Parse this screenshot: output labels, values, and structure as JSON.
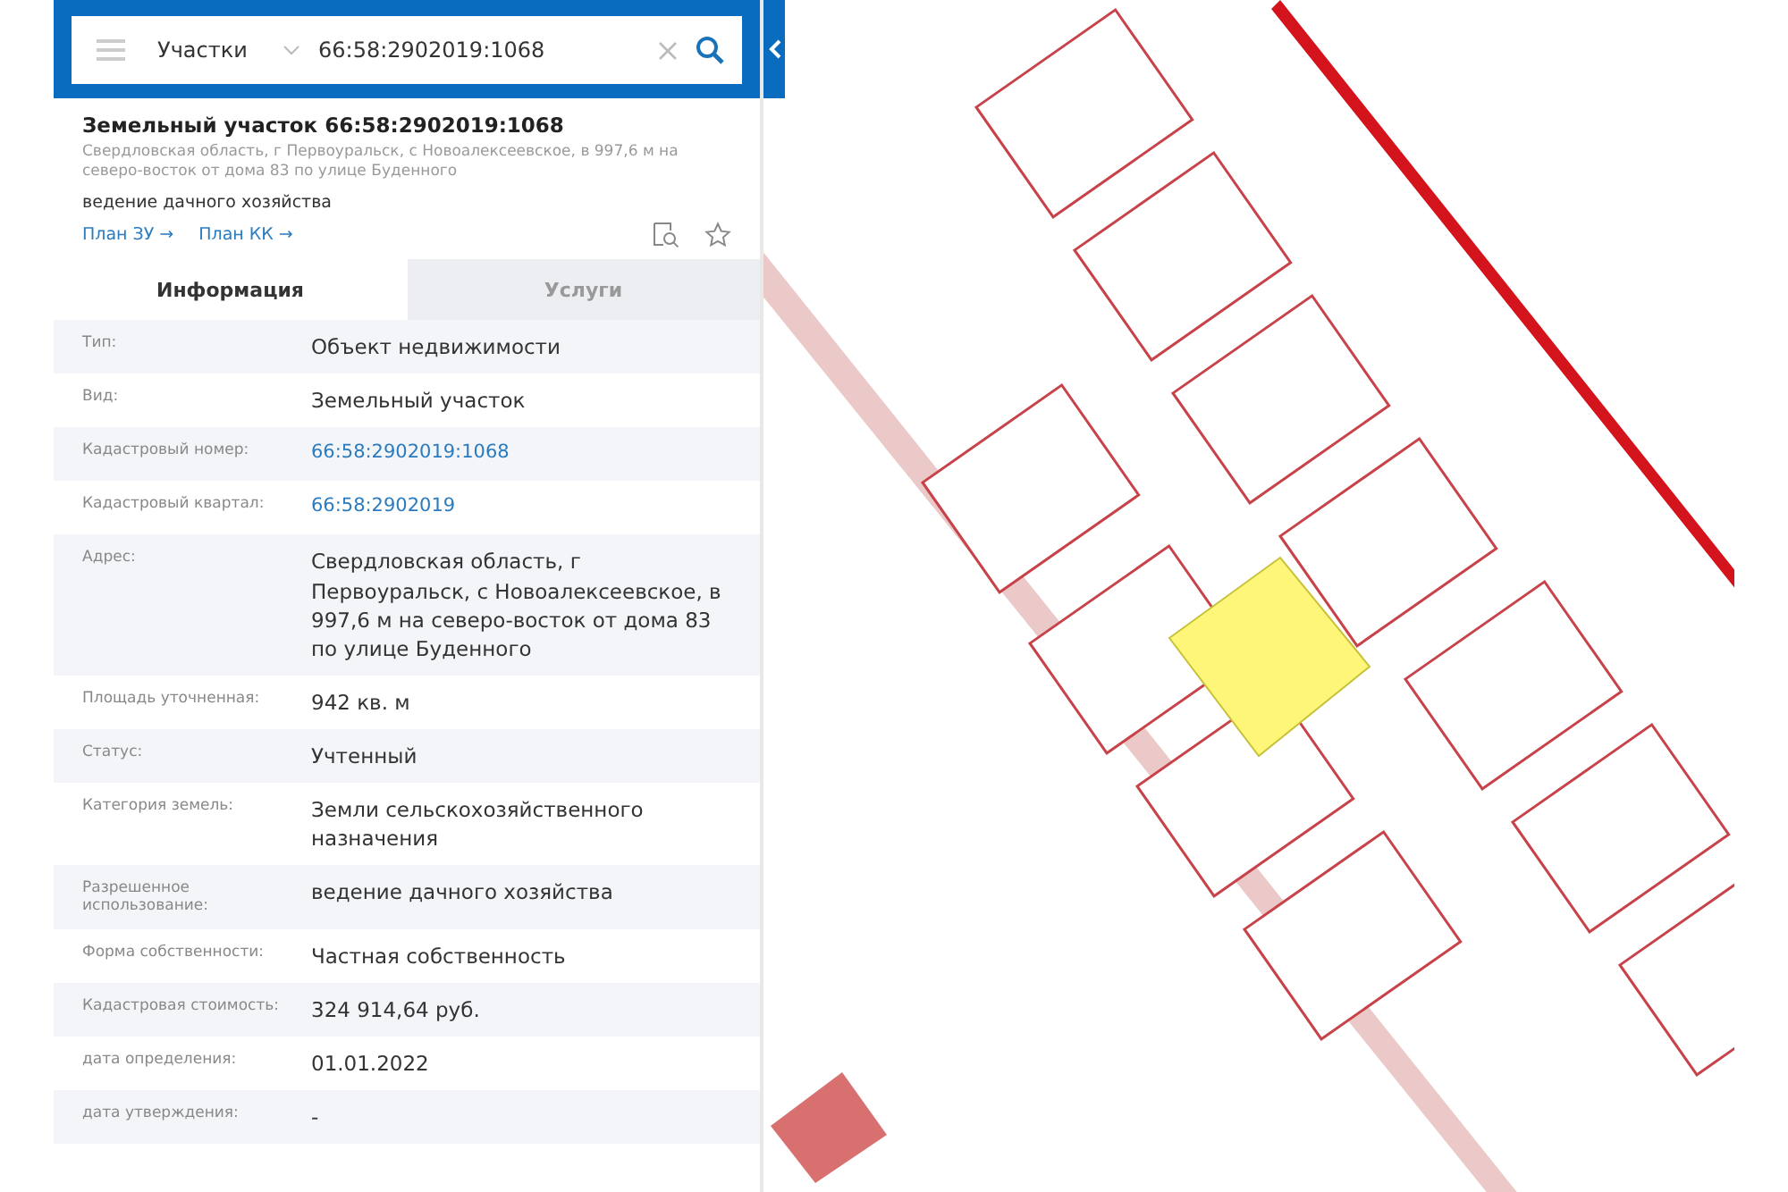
{
  "search": {
    "category": "Участки",
    "value": "66:58:2902019:1068"
  },
  "object": {
    "title": "Земельный участок 66:58:2902019:1068",
    "address": "Свердловская область, г Первоуральск, с Новоалексеевское, в 997,6 м на северо-восток от дома 83 по улице Буденного",
    "purpose": "ведение дачного хозяйства",
    "links": [
      "План ЗУ →",
      "План КК →"
    ]
  },
  "tabs": [
    {
      "label": "Информация",
      "selected": true
    },
    {
      "label": "Услуги",
      "selected": false
    }
  ],
  "rows": [
    {
      "label": "Тип:",
      "value": "Объект недвижимости",
      "kind": "text"
    },
    {
      "label": "Вид:",
      "value": "Земельный участок",
      "kind": "text"
    },
    {
      "label": "Кадастровый номер:",
      "value": "66:58:2902019:1068",
      "kind": "link"
    },
    {
      "label": "Кадастровый квартал:",
      "value": "66:58:2902019",
      "kind": "link"
    },
    {
      "label": "Адрес:",
      "value": "Свердловская область, г Первоуральск, с Новоалексеевское, в 997,6 м на северо-восток от дома 83 по улице Буденного",
      "kind": "text"
    },
    {
      "label": "Площадь уточненная:",
      "value": "942 кв. м",
      "kind": "text"
    },
    {
      "label": "Статус:",
      "value": "Учтенный",
      "kind": "text"
    },
    {
      "label": "Категория земель:",
      "value": "Земли сельскохозяйственного назначения",
      "kind": "text"
    },
    {
      "label": "Разрешенное использование:",
      "value": "ведение дачного хозяйства",
      "kind": "text"
    },
    {
      "label": "Форма собственности:",
      "value": "Частная собственность",
      "kind": "text"
    },
    {
      "label": "Кадастровая стоимость:",
      "value": "324 914,64 руб.",
      "kind": "text"
    },
    {
      "label": "дата определения:",
      "value": "01.01.2022",
      "kind": "text"
    },
    {
      "label": "дата утверждения:",
      "value": "-",
      "kind": "text"
    }
  ]
}
